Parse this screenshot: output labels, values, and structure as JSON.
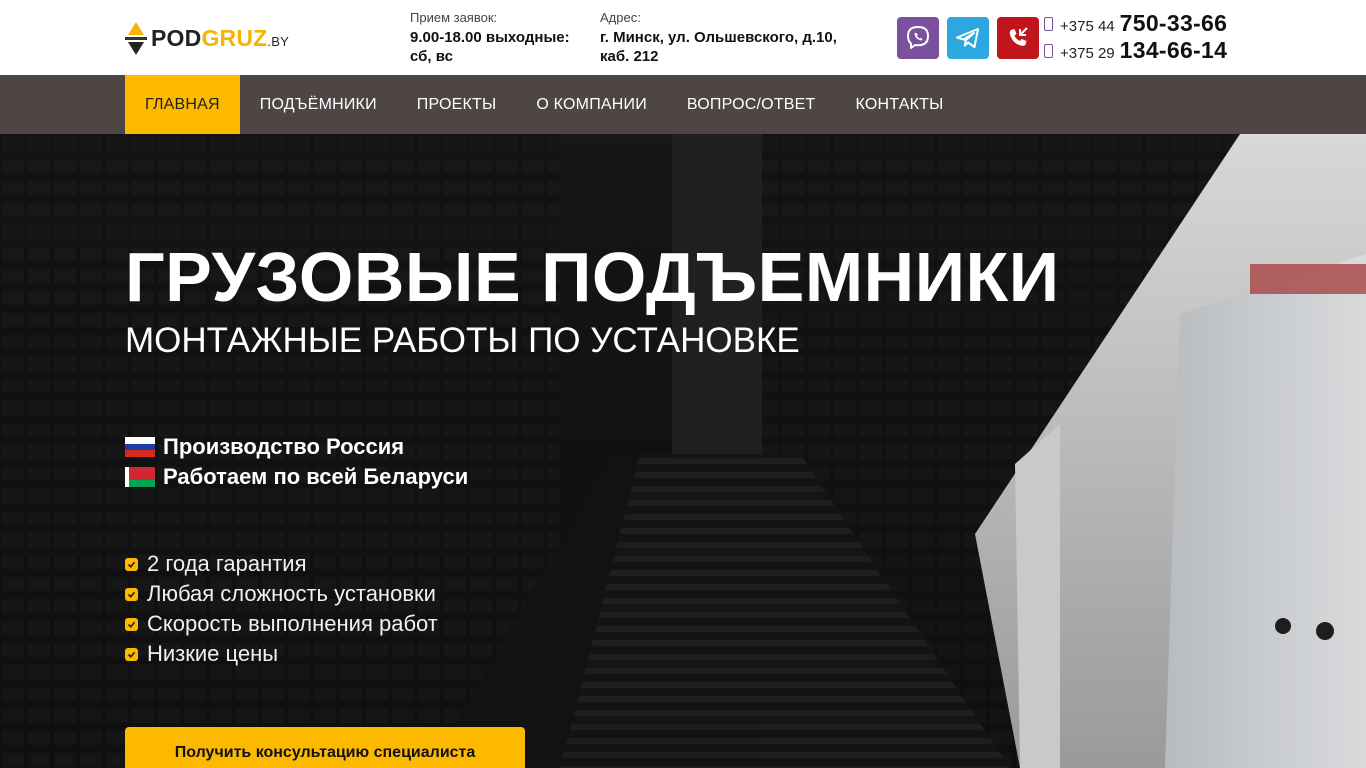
{
  "header": {
    "logo": {
      "part1": "POD",
      "part2": "GRUZ",
      "domain": ".BY"
    },
    "hours": {
      "label": "Прием заявок:",
      "value": "9.00-18.00 выходные: сб, вс"
    },
    "address": {
      "label": "Адрес:",
      "value": "г. Минск, ул. Ольшевского, д.10, каб. 212"
    },
    "messengers": [
      {
        "icon": "viber-icon",
        "color": "#7b519d"
      },
      {
        "icon": "telegram-icon",
        "color": "#2ea6df"
      },
      {
        "icon": "phone-call-icon",
        "color": "#c0161b"
      }
    ],
    "phones": [
      {
        "code": "+375 44",
        "number": "750-33-66"
      },
      {
        "code": "+375 29",
        "number": "134-66-14"
      }
    ]
  },
  "nav": {
    "items": [
      {
        "label": "ГЛАВНАЯ",
        "active": true
      },
      {
        "label": "ПОДЪЁМНИКИ",
        "active": false
      },
      {
        "label": "ПРОЕКТЫ",
        "active": false
      },
      {
        "label": "О КОМПАНИИ",
        "active": false
      },
      {
        "label": "ВОПРОС/ОТВЕТ",
        "active": false
      },
      {
        "label": "КОНТАКТЫ",
        "active": false
      }
    ]
  },
  "hero": {
    "title": "ГРУЗОВЫЕ ПОДЪЕМНИКИ",
    "subtitle": "МОНТАЖНЫЕ РАБОТЫ ПО УСТАНОВКЕ",
    "features": [
      {
        "flag": "russia-flag-icon",
        "text": "Производство Россия"
      },
      {
        "flag": "belarus-flag-icon",
        "text": "Работаем по всей Беларуси"
      }
    ],
    "benefits": [
      "2 года гарантия",
      "Любая сложность установки",
      "Скорость выполнения работ",
      "Низкие цены"
    ],
    "cta_label": "Получить консультацию специалиста"
  },
  "colors": {
    "accent": "#fcb900",
    "nav_bg": "#4d4644"
  }
}
